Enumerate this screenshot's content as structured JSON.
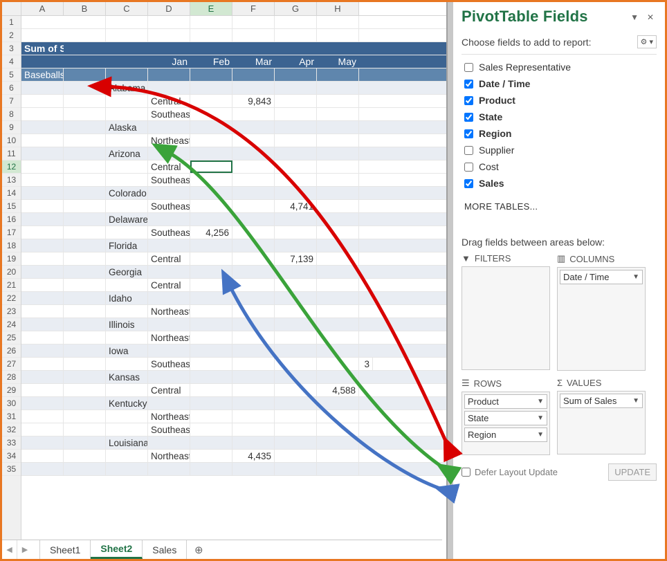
{
  "columns": [
    "A",
    "B",
    "C",
    "D",
    "E",
    "F",
    "G",
    "H"
  ],
  "sel_col": "E",
  "sel_row": "12",
  "title_cell": "Sum of Sales",
  "months": [
    "Jan",
    "Feb",
    "Mar",
    "Apr",
    "May"
  ],
  "product": "Baseballs",
  "rows": [
    {
      "kind": "state",
      "label": "Alabama"
    },
    {
      "kind": "region",
      "label": "Central",
      "vals": {
        "Feb": "9,843"
      }
    },
    {
      "kind": "region",
      "label": "Southeast"
    },
    {
      "kind": "state",
      "label": "Alaska"
    },
    {
      "kind": "region",
      "label": "Northeast"
    },
    {
      "kind": "state",
      "label": "Arizona"
    },
    {
      "kind": "region",
      "label": "Central"
    },
    {
      "kind": "region",
      "label": "Southeast"
    },
    {
      "kind": "state",
      "label": "Colorado"
    },
    {
      "kind": "region",
      "label": "Southeast",
      "vals": {
        "Mar": "4,741"
      }
    },
    {
      "kind": "state",
      "label": "Delaware"
    },
    {
      "kind": "region",
      "label": "Southeast",
      "vals": {
        "Jan": "4,256"
      }
    },
    {
      "kind": "state",
      "label": "Florida"
    },
    {
      "kind": "region",
      "label": "Central",
      "vals": {
        "Mar": "7,139"
      }
    },
    {
      "kind": "state",
      "label": "Georgia"
    },
    {
      "kind": "region",
      "label": "Central"
    },
    {
      "kind": "state",
      "label": "Idaho"
    },
    {
      "kind": "region",
      "label": "Northeast"
    },
    {
      "kind": "state",
      "label": "Illinois"
    },
    {
      "kind": "region",
      "label": "Northeast"
    },
    {
      "kind": "state",
      "label": "Iowa"
    },
    {
      "kind": "region",
      "label": "Southeast",
      "vals": {
        "May": "3"
      }
    },
    {
      "kind": "state",
      "label": "Kansas"
    },
    {
      "kind": "region",
      "label": "Central",
      "vals": {
        "Apr": "4,588"
      }
    },
    {
      "kind": "state",
      "label": "Kentucky"
    },
    {
      "kind": "region",
      "label": "Northeast"
    },
    {
      "kind": "region",
      "label": "Southeast"
    },
    {
      "kind": "state",
      "label": "Louisiana"
    },
    {
      "kind": "region",
      "label": "Northeast",
      "vals": {
        "Feb": "4,435"
      }
    },
    {
      "kind": "state_trunc",
      "label": ""
    }
  ],
  "pane": {
    "title": "PivotTable Fields",
    "choose": "Choose fields to add to report:",
    "fields": [
      {
        "label": "Sales Representative",
        "checked": false
      },
      {
        "label": "Date / Time",
        "checked": true
      },
      {
        "label": "Product",
        "checked": true
      },
      {
        "label": "State",
        "checked": true
      },
      {
        "label": "Region",
        "checked": true
      },
      {
        "label": "Supplier",
        "checked": false
      },
      {
        "label": "Cost",
        "checked": false
      },
      {
        "label": "Sales",
        "checked": true
      }
    ],
    "more": "MORE TABLES...",
    "drag": "Drag fields between areas below:",
    "areas": {
      "filters": "FILTERS",
      "columns": "COLUMNS",
      "rows": "ROWS",
      "values": "VALUES"
    },
    "column_chips": [
      "Date / Time"
    ],
    "row_chips": [
      "Product",
      "State",
      "Region"
    ],
    "value_chips": [
      "Sum of Sales"
    ],
    "defer": "Defer Layout Update",
    "update": "UPDATE"
  },
  "tabs": [
    "Sheet1",
    "Sheet2",
    "Sales"
  ],
  "active_tab": "Sheet2"
}
